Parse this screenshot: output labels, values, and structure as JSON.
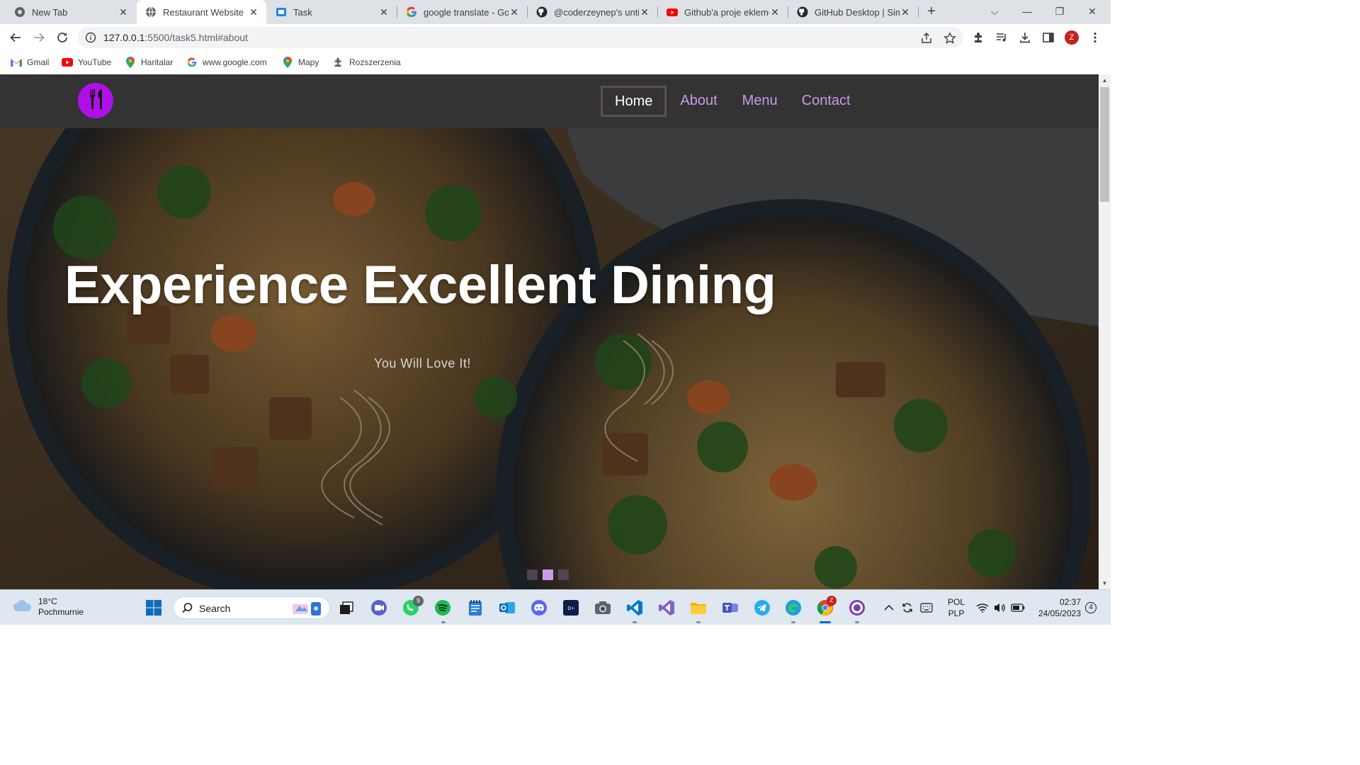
{
  "browser": {
    "tabs": [
      {
        "title": "New Tab",
        "icon": "chrome-icon",
        "active": false
      },
      {
        "title": "Restaurant Website",
        "icon": "globe-icon",
        "active": true
      },
      {
        "title": "Task",
        "icon": "task-icon",
        "active": false
      },
      {
        "title": "google translate - Goo",
        "icon": "google-icon",
        "active": false
      },
      {
        "title": "@coderzeynep's untitl",
        "icon": "github-icon",
        "active": false
      },
      {
        "title": "Github'a proje ekleme",
        "icon": "youtube-icon",
        "active": false
      },
      {
        "title": "GitHub Desktop | Simp",
        "icon": "github-icon",
        "active": false
      }
    ],
    "url_host": "127.0.0.1",
    "url_path": ":5500/task5.html#about",
    "profile_initial": "Z",
    "bookmarks": [
      {
        "label": "Gmail",
        "icon": "gmail-icon"
      },
      {
        "label": "YouTube",
        "icon": "youtube-icon"
      },
      {
        "label": "Haritalar",
        "icon": "maps-pin-icon"
      },
      {
        "label": "www.google.com",
        "icon": "google-icon"
      },
      {
        "label": "Mapy",
        "icon": "maps-pin-icon"
      },
      {
        "label": "Rozszerzenia",
        "icon": "puzzle-icon"
      }
    ]
  },
  "site": {
    "nav": {
      "home": "Home",
      "about": "About",
      "menu": "Menu",
      "contact": "Contact"
    },
    "hero": {
      "title": "Experience Excellent Dining",
      "subtitle": "You Will Love It!",
      "slide_count": 3,
      "active_slide": 2
    },
    "colors": {
      "nav_bg": "#333333",
      "accent": "#c79be6",
      "logo": "#b010e8"
    }
  },
  "taskbar": {
    "weather_temp": "18°C",
    "weather_desc": "Pochmurnie",
    "search_label": "Search",
    "whatsapp_badge": "9",
    "chrome_badge": "Z",
    "lang_top": "POL",
    "lang_bottom": "PLP",
    "time": "02:37",
    "date": "24/05/2023",
    "notification_count": "4"
  }
}
